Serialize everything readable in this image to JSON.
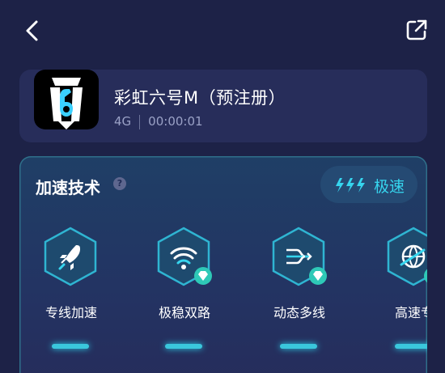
{
  "topbar": {
    "back_icon": "chevron-left-icon",
    "share_icon": "external-share-icon"
  },
  "game": {
    "title": "彩虹六号M（预注册）",
    "network": "4G",
    "timer": "00:00:01",
    "icon": "rainbow-six-logo-icon"
  },
  "accel": {
    "title": "加速技术",
    "help_icon": "question-mark-icon",
    "mode_label": "极速",
    "mode_icon": "triple-lightning-bolt-icon",
    "accent_color": "#36d5ee",
    "features": [
      {
        "label": "专线加速",
        "icon": "rocket-icon",
        "premium": false
      },
      {
        "label": "极稳双路",
        "icon": "dual-wifi-icon",
        "premium": true
      },
      {
        "label": "动态多线",
        "icon": "multi-line-icon",
        "premium": true
      },
      {
        "label": "高速专",
        "icon": "globe-plane-icon",
        "premium": true
      }
    ]
  }
}
